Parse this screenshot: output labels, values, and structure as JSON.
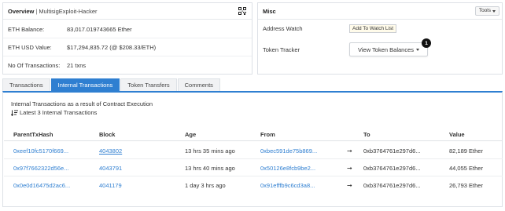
{
  "overview": {
    "label": "Overview",
    "separator": "|",
    "name": "MultisigExploit-Hacker",
    "qr_icon": "qr-code-icon",
    "rows": [
      {
        "label": "ETH Balance:",
        "value": "83,017.019743665 Ether"
      },
      {
        "label": "ETH USD Value:",
        "value": "$17,294,835.72 (@ $208.33/ETH)"
      },
      {
        "label": "No Of Transactions:",
        "value": "21 txns"
      }
    ]
  },
  "misc": {
    "title": "Misc",
    "tools_label": "Tools",
    "address_watch_label": "Address Watch",
    "add_watch_button": "Add To Watch List",
    "token_tracker_label": "Token Tracker",
    "token_select_label": "View Token Balances",
    "badge": "1"
  },
  "tabs": [
    {
      "label": "Transactions",
      "active": false
    },
    {
      "label": "Internal Transactions",
      "active": true
    },
    {
      "label": "Token Transfers",
      "active": false
    },
    {
      "label": "Comments",
      "active": false
    }
  ],
  "internal": {
    "description": "Internal Transactions as a result of Contract Execution",
    "latest": "Latest 3 Internal Transactions",
    "columns": [
      "ParentTxHash",
      "Block",
      "Age",
      "From",
      "To",
      "Value"
    ],
    "rows": [
      {
        "hash": "0xeef10fc5170f669...",
        "block": "4043802",
        "age": "13 hrs 35 mins ago",
        "from": "0xbec591de75b869...",
        "arrow": "➞",
        "to": "0xb3764761e297d6...",
        "value": "82,189 Ether"
      },
      {
        "hash": "0x97f7662322d56e...",
        "block": "4043791",
        "age": "13 hrs 40 mins ago",
        "from": "0x50126e8fcb9be2...",
        "arrow": "➞",
        "to": "0xb3764761e297d6...",
        "value": "44,055 Ether"
      },
      {
        "hash": "0x0e0d16475d2ac6...",
        "block": "4041179",
        "age": "1 day 3 hrs ago",
        "from": "0x91efffb9c6cd3a8...",
        "arrow": "➞",
        "to": "0xb3764761e297d6...",
        "value": "26,793 Ether"
      }
    ]
  },
  "colors": {
    "accent": "#2f7fd1",
    "border": "#dde1e6"
  }
}
